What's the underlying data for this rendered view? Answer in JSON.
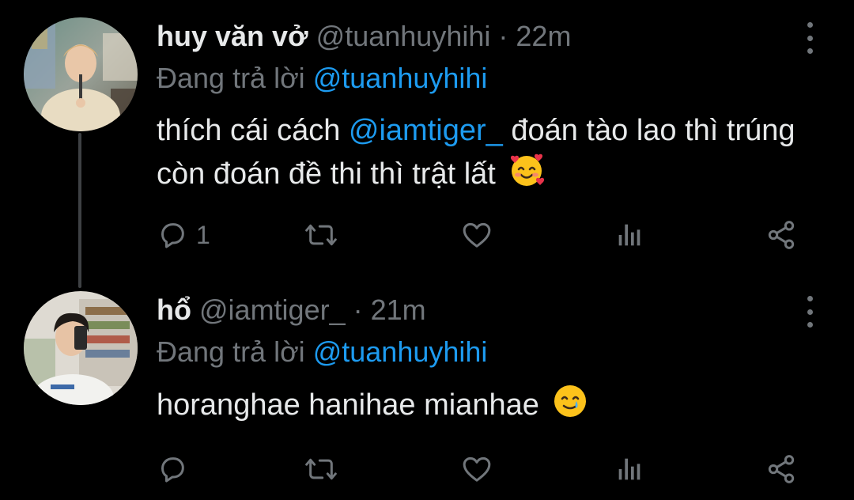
{
  "colors": {
    "background": "#000000",
    "primary_text": "#e7e9ea",
    "secondary_text": "#71767b",
    "accent": "#1d9bf0",
    "thread_line": "#3e4144"
  },
  "tweets": [
    {
      "display_name": "huy văn vở",
      "handle": "@tuanhuyhihi",
      "separator": "·",
      "time": "22m",
      "reply_prefix": "Đang trả lời",
      "reply_to": "@tuanhuyhihi",
      "text_before": "thích cái cách",
      "mention": "@iamtiger_",
      "text_after": "đoán tào lao thì trúng còn đoán đề thi thì trật lất",
      "emoji_icon": "smiling-face-with-hearts-icon",
      "reply_count": "1",
      "retweet_count": "",
      "like_count": ""
    },
    {
      "display_name": "hổ",
      "handle": "@iamtiger_",
      "separator": "·",
      "time": "21m",
      "reply_prefix": "Đang trả lời",
      "reply_to": "@tuanhuyhihi",
      "text_before": "horanghae hanihae mianhae",
      "mention": "",
      "text_after": "",
      "emoji_icon": "smiling-face-with-tear-icon",
      "reply_count": "",
      "retweet_count": "",
      "like_count": ""
    }
  ]
}
